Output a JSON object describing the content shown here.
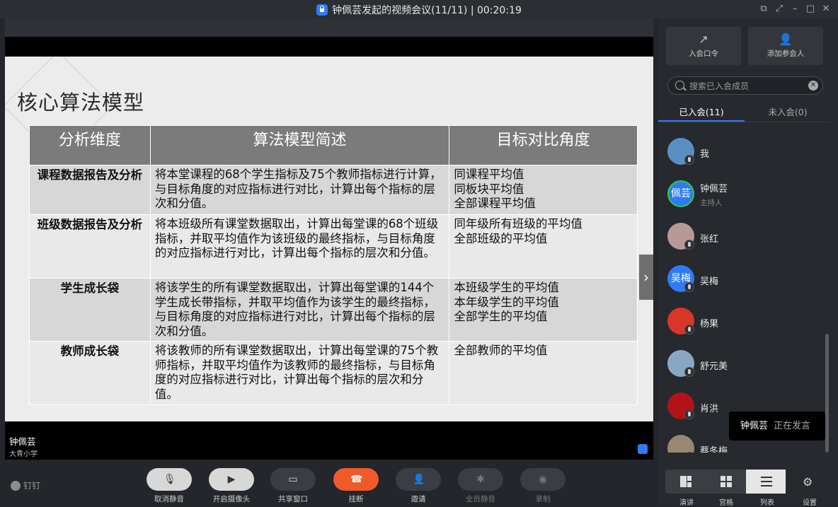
{
  "window": {
    "title": "钟佩芸发起的视频会议(11/11) | 00:20:19"
  },
  "slide": {
    "title": "核心算法模型",
    "headers": [
      "分析维度",
      "算法模型简述",
      "目标对比角度"
    ],
    "rows": [
      {
        "dimension": "课程数据报告及分析",
        "summary": "将本堂课程的68个学生指标及75个教师指标进行计算，与目标角度的对应指标进行对比，计算出每个指标的层次和分值。",
        "targets": [
          "同课程平均值",
          "同板块平均值",
          "全部课程平均值"
        ]
      },
      {
        "dimension": "班级数据报告及分析",
        "summary": "将本班级所有课堂数据取出，计算出每堂课的68个班级指标，并取平均值作为该班级的最终指标，与目标角度的对应指标进行对比，计算出每个指标的层次和分值。",
        "targets": [
          "同年级所有班级的平均值",
          "全部班级的平均值"
        ]
      },
      {
        "dimension": "学生成长袋",
        "summary": "将该学生的所有课堂数据取出，计算出每堂课的144个学生成长带指标，并取平均值作为该学生的最终指标，与目标角度的对应指标进行对比，计算出每个指标的层次和分值。",
        "targets": [
          "本班级学生的平均值",
          "本年级学生的平均值",
          "全部学生的平均值"
        ]
      },
      {
        "dimension": "教师成长袋",
        "summary": "将该教师的所有课堂数据取出，计算出每堂课的75个教师指标，并取平均值作为该教师的最终指标，与目标角度的对应指标进行对比，计算出每个指标的层次和分值。",
        "targets": [
          "全部教师的平均值"
        ]
      }
    ]
  },
  "video": {
    "speaker_name": "钟佩芸",
    "speaker_org": "大青小学"
  },
  "toolbar": {
    "logo": "钉钉",
    "buttons": [
      {
        "label": "取消静音",
        "icon": "microphone-muted-icon"
      },
      {
        "label": "开启摄像头",
        "icon": "camera-off-icon"
      },
      {
        "label": "共享窗口",
        "icon": "share-screen-icon"
      },
      {
        "label": "挂断",
        "icon": "hangup-icon"
      },
      {
        "label": "邀请",
        "icon": "invite-icon"
      },
      {
        "label": "全员静音",
        "icon": "mute-all-icon"
      },
      {
        "label": "录制",
        "icon": "record-icon"
      }
    ]
  },
  "panel": {
    "join_code": "入会口令",
    "add_participant": "添加参会人",
    "search_placeholder": "搜索已入会成员",
    "tab_joined": "已入会(11)",
    "tab_not_joined": "未入会(0)",
    "members": [
      {
        "name": "我",
        "role": "",
        "avatar_text": ""
      },
      {
        "name": "钟佩芸",
        "role": "主持人",
        "avatar_text": "佩芸"
      },
      {
        "name": "张红",
        "role": "",
        "avatar_text": ""
      },
      {
        "name": "吴梅",
        "role": "",
        "avatar_text": "吴梅"
      },
      {
        "name": "杨果",
        "role": "",
        "avatar_text": ""
      },
      {
        "name": "舒元美",
        "role": "",
        "avatar_text": ""
      },
      {
        "name": "肖洪",
        "role": "",
        "avatar_text": ""
      },
      {
        "name": "蔡冬梅",
        "role": "",
        "avatar_text": ""
      }
    ],
    "speaking_name": "钟佩芸",
    "speaking_status": "正在发言",
    "views": [
      "演讲",
      "宫格",
      "列表"
    ],
    "settings": "设置"
  },
  "colors": {
    "accent": "#2f7bf5",
    "hangup": "#f05a28"
  }
}
